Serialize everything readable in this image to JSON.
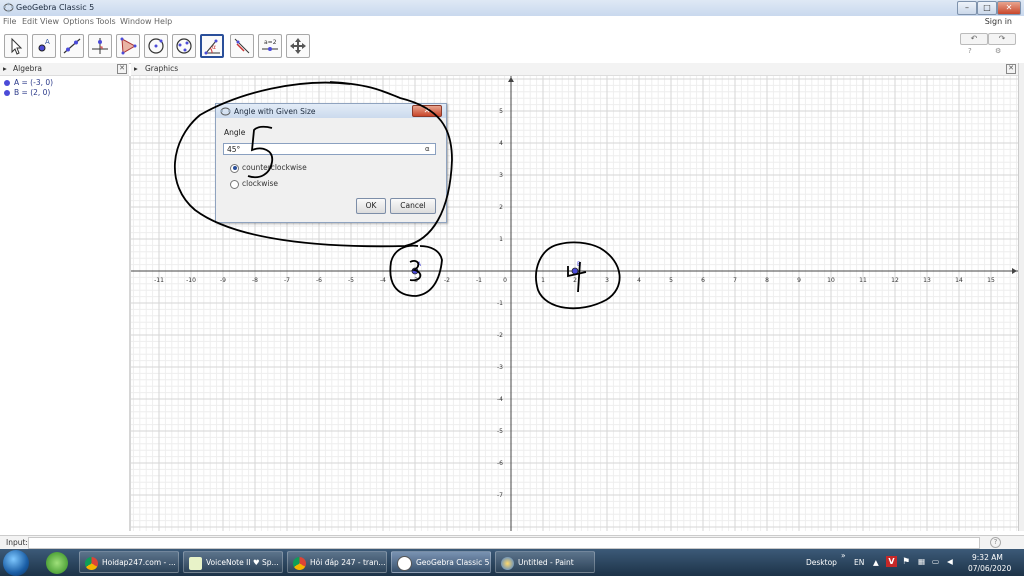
{
  "window": {
    "title": "GeoGebra Classic 5",
    "min": "–",
    "max": "□",
    "close": "✕"
  },
  "menu": {
    "items": [
      "File",
      "Edit",
      "View",
      "Options",
      "Tools",
      "Window",
      "Help"
    ],
    "signin": "Sign in"
  },
  "toolbar": {
    "undo": "↶",
    "redo": "↷",
    "help": "?",
    "settings": "⚙"
  },
  "algebra": {
    "header": "Algebra",
    "items": [
      "A = (-3, 0)",
      "B = (2, 0)"
    ]
  },
  "graphics": {
    "header": "Graphics",
    "xticks": [
      "-11",
      "-10",
      "-9",
      "-8",
      "-7",
      "-6",
      "-5",
      "-4",
      "-3",
      "-2",
      "-1",
      "0",
      "1",
      "2",
      "3",
      "4",
      "5",
      "6",
      "7",
      "8",
      "9",
      "10",
      "11",
      "12",
      "13",
      "14",
      "15"
    ],
    "yticks_pos": [
      "5",
      "4",
      "3",
      "2",
      "1"
    ],
    "yticks_neg": [
      "-1",
      "-2",
      "-3",
      "-4",
      "-5",
      "-6",
      "-7"
    ],
    "point_a": "A",
    "point_b": "B",
    "annotations": {
      "n5": "5",
      "n3": "3",
      "n4": "4"
    }
  },
  "dialog": {
    "title": "Angle with Given Size",
    "label": "Angle",
    "value": "45°",
    "alpha": "α",
    "option_ccw": "counterclockwise",
    "option_cw": "clockwise",
    "ok": "OK",
    "cancel": "Cancel"
  },
  "inputbar": {
    "label": "Input:",
    "help": "?"
  },
  "taskbar": {
    "tasks": [
      "Hoidap247.com - ...",
      "VoiceNote II ♥ Sp...",
      "Hỏi đáp 247 - tran...",
      "GeoGebra Classic 5",
      "Untitled - Paint"
    ],
    "desktop": "Desktop",
    "chevron": "»",
    "lang": "EN",
    "time": "9:32 AM",
    "date": "07/06/2020"
  },
  "colors": {
    "accent": "#2a4f9a",
    "point": "#4b4bd8",
    "ink": "#000000"
  }
}
